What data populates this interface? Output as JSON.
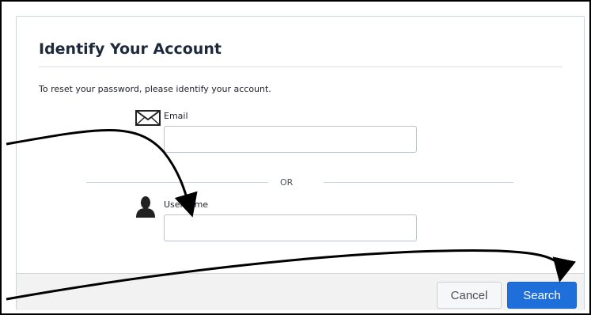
{
  "dialog": {
    "title": "Identify Your Account",
    "instructions": "To reset your password, please identify your account."
  },
  "email": {
    "label": "Email",
    "value": "",
    "icon": "envelope-icon"
  },
  "separator": {
    "text": "OR"
  },
  "username": {
    "label": "Username",
    "value": "",
    "icon": "user-silhouette-icon"
  },
  "footer": {
    "cancel_label": "Cancel",
    "search_label": "Search"
  },
  "colors": {
    "accent": "#1f6fdb",
    "title": "#1e2a3b",
    "footer_bg": "#f2f2f2"
  }
}
